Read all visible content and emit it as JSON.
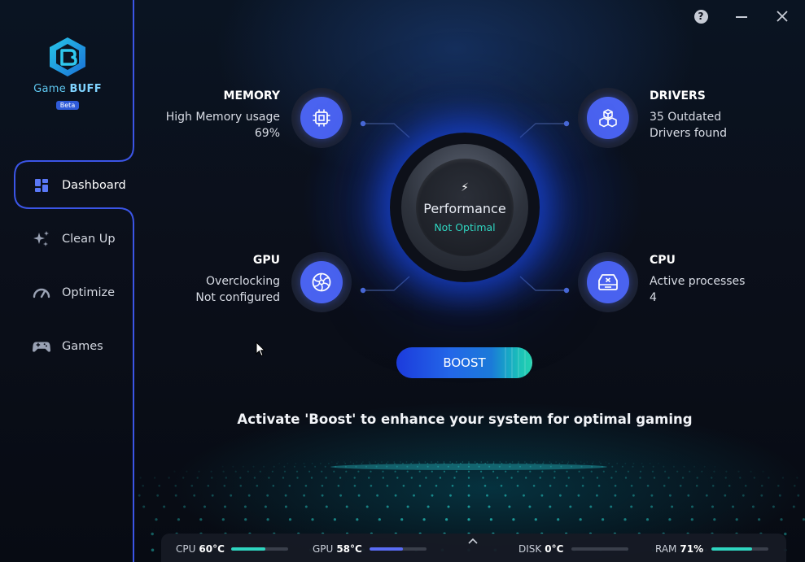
{
  "app": {
    "brand_prefix": "Game",
    "brand_suffix": "BUFF",
    "badge": "Beta"
  },
  "window": {
    "help": "?",
    "minimize": "–",
    "close": "✕"
  },
  "sidebar": {
    "items": [
      {
        "label": "Dashboard",
        "icon": "dashboard-icon",
        "active": true
      },
      {
        "label": "Clean Up",
        "icon": "sparkle-icon",
        "active": false
      },
      {
        "label": "Optimize",
        "icon": "gauge-icon",
        "active": false
      },
      {
        "label": "Games",
        "icon": "gamepad-icon",
        "active": false
      }
    ]
  },
  "stats": {
    "memory": {
      "title": "MEMORY",
      "line1": "High Memory usage",
      "line2": "69%",
      "icon": "chip-icon"
    },
    "drivers": {
      "title": "DRIVERS",
      "line1": "35 Outdated",
      "line2": "Drivers found",
      "icon": "cubes-icon"
    },
    "gpu": {
      "title": "GPU",
      "line1": "Overclocking",
      "line2": "Not configured",
      "icon": "fan-icon"
    },
    "cpu": {
      "title": "CPU",
      "line1": "Active processes",
      "line2": "4",
      "icon": "process-icon"
    }
  },
  "performance": {
    "bolt": "⚡",
    "title": "Performance",
    "status": "Not Optimal"
  },
  "boost": {
    "label": "BOOST"
  },
  "tagline": "Activate 'Boost' to enhance your system for optimal gaming",
  "bottom_bar": {
    "cpu": {
      "label": "CPU",
      "value": "60°C",
      "level": 0.6,
      "color": "#2fd5c0"
    },
    "gpu": {
      "label": "GPU",
      "value": "58°C",
      "level": 0.58,
      "color": "#5a6cf5"
    },
    "disk": {
      "label": "DISK",
      "value": "0°C",
      "level": 0.0,
      "color": "#2fd5c0"
    },
    "ram": {
      "label": "RAM",
      "value": "71%",
      "level": 0.71,
      "color": "#2fd5c0"
    }
  },
  "colors": {
    "accent": "#4a63f0",
    "teal": "#2fd5c0",
    "sidebar_line": "#3b55e6"
  }
}
